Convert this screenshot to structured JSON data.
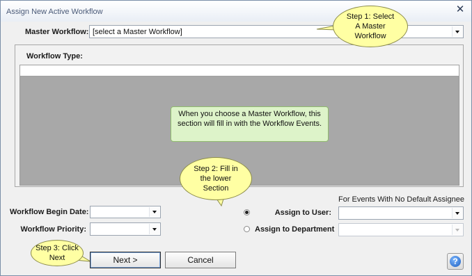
{
  "window": {
    "title": "Assign New Active Workflow",
    "close_glyph": "✕"
  },
  "master_workflow": {
    "label": "Master Workflow:",
    "value": "[select a Master Workflow]"
  },
  "panel": {
    "workflow_type_label": "Workflow Type:",
    "info_note": "When you choose a Master Workflow, this section will fill in with the Workflow Events."
  },
  "callouts": {
    "step1": "Step 1: Select A Master Workflow",
    "step2": "Step 2: Fill in the lower Section",
    "step3": "Step 3: Click Next"
  },
  "form": {
    "begin_date_label": "Workflow Begin Date:",
    "begin_date_value": "",
    "priority_label": "Workflow Priority:",
    "priority_value": "",
    "no_default_assignee_label": "For Events With No Default Assignee",
    "assign_user_label": "Assign to User:",
    "assign_user_value": "",
    "assign_user_selected": true,
    "assign_department_label": "Assign to Department",
    "assign_department_value": "",
    "assign_department_selected": false
  },
  "buttons": {
    "next": "Next >",
    "cancel": "Cancel",
    "help_glyph": "?"
  },
  "colors": {
    "callout_fill": "#ffffa3",
    "note_fill": "#ddf3c9",
    "grid_fill": "#a8a8a8",
    "help_icon": "#1f5fbf"
  },
  "icons": [
    "close-icon",
    "chevron-down-icon",
    "help-icon"
  ]
}
